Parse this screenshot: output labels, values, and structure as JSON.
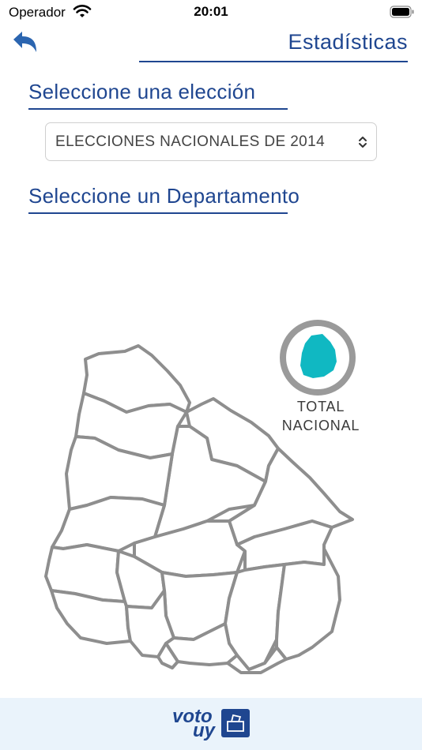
{
  "status_bar": {
    "carrier": "Operador",
    "time": "20:01"
  },
  "header": {
    "title": "Estadísticas",
    "back_icon": "back-arrow-icon"
  },
  "election_section": {
    "label": "Seleccione una elección",
    "selected": "ELECCIONES NACIONALES DE 2014"
  },
  "department_section": {
    "label": "Seleccione un Departamento"
  },
  "total_nacional": {
    "label_line1": "TOTAL",
    "label_line2": "NACIONAL"
  },
  "footer": {
    "logo_word1": "voto",
    "logo_word2": "uy"
  },
  "colors": {
    "accent": "#1f4690",
    "map_fill_total": "#10b8c2",
    "map_border": "#8e8e8e",
    "footer_bg": "#eaf3fb"
  }
}
